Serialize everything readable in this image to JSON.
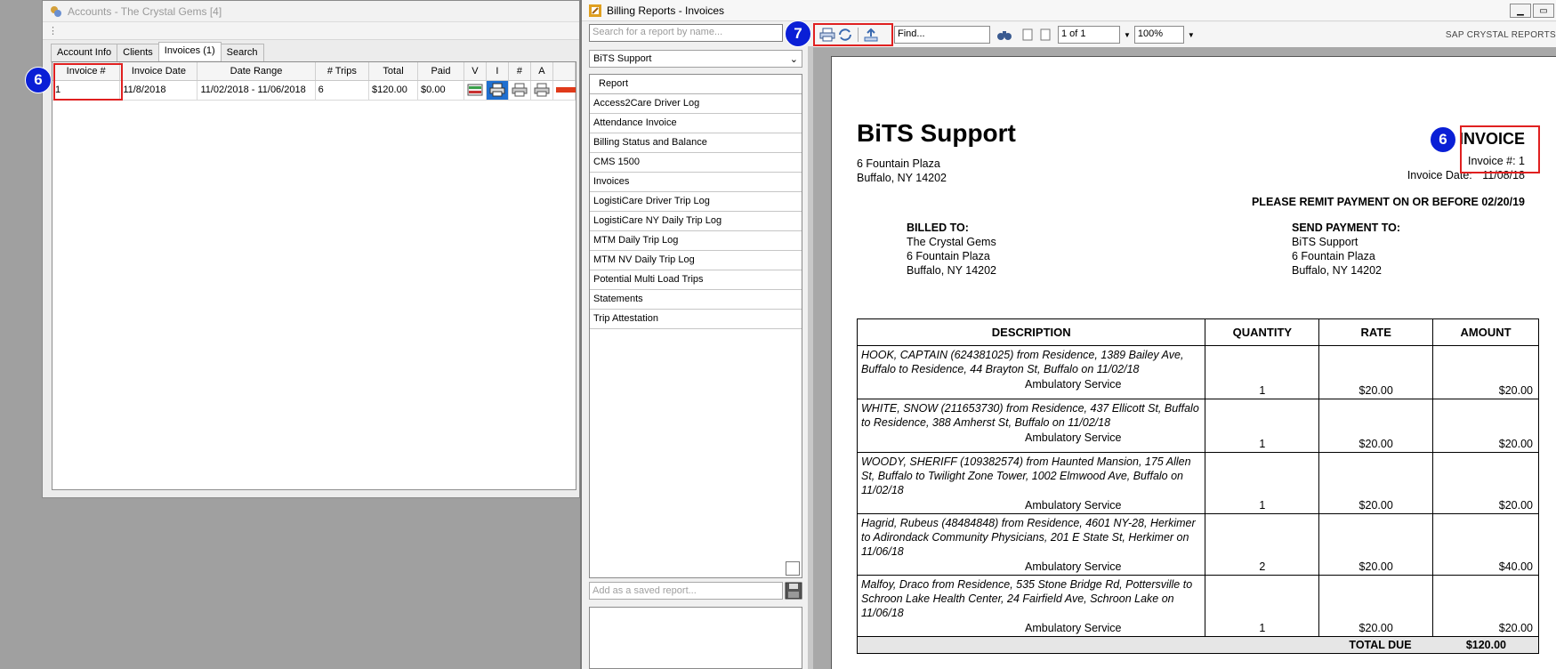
{
  "accounts": {
    "title": "Accounts - The Crystal Gems [4]",
    "tabs": [
      "Account Info",
      "Clients",
      "Invoices (1)",
      "Search"
    ],
    "columns": [
      "Invoice #",
      "Invoice Date",
      "Date Range",
      "# Trips",
      "Total",
      "Paid",
      "V",
      "I",
      "#",
      "A"
    ],
    "rows": [
      {
        "invoice": "1",
        "date": "11/8/2018",
        "range": "11/02/2018 - 11/06/2018",
        "trips": "6",
        "total": "$120.00",
        "paid": "$0.00"
      }
    ],
    "badge": "6"
  },
  "billing": {
    "title": "Billing Reports - Invoices",
    "search_placeholder": "Search for a report by name...",
    "selected_company": "BiTS Support",
    "report_header": "Report",
    "reports": [
      "Access2Care Driver Log",
      "Attendance Invoice",
      "Billing Status and Balance",
      "CMS 1500",
      "Invoices",
      "LogistiCare Driver Trip Log",
      "LogistiCare NY Daily Trip Log",
      "MTM Daily Trip Log",
      "MTM NV Daily Trip Log",
      "Potential Multi Load Trips",
      "Statements",
      "Trip Attestation"
    ],
    "saved_placeholder": "Add as a saved report...",
    "toolbar": {
      "badge": "7",
      "find": "Find...",
      "page": "1 of 1",
      "zoom": "100%",
      "brand": "SAP CRYSTAL REPORTS"
    }
  },
  "invoice": {
    "company": "BiTS Support",
    "company_addr1": "6 Fountain Plaza",
    "company_addr2": "Buffalo, NY 14202",
    "title": "INVOICE",
    "badge": "6",
    "number_label": "Invoice #:",
    "number": "1",
    "date_label": "Invoice Date:",
    "date": "11/08/18",
    "remit": "PLEASE REMIT PAYMENT ON OR BEFORE 02/20/19",
    "billed_to": {
      "head": "BILLED TO:",
      "l1": "The Crystal Gems",
      "l2": "6 Fountain Plaza",
      "l3": "Buffalo, NY 14202"
    },
    "send_to": {
      "head": "SEND PAYMENT TO:",
      "l1": "BiTS Support",
      "l2": "6 Fountain Plaza",
      "l3": "Buffalo, NY 14202"
    },
    "columns": [
      "DESCRIPTION",
      "QUANTITY",
      "RATE",
      "AMOUNT"
    ],
    "items": [
      {
        "desc": "HOOK, CAPTAIN (624381025) from Residence, 1389 Bailey Ave, Buffalo to Residence, 44 Brayton St, Buffalo on 11/02/18",
        "service": "Ambulatory Service",
        "qty": "1",
        "rate": "$20.00",
        "amount": "$20.00"
      },
      {
        "desc": "WHITE, SNOW (211653730) from Residence, 437 Ellicott St, Buffalo to Residence, 388 Amherst St, Buffalo on 11/02/18",
        "service": "Ambulatory Service",
        "qty": "1",
        "rate": "$20.00",
        "amount": "$20.00"
      },
      {
        "desc": "WOODY, SHERIFF (109382574) from Haunted Mansion, 175 Allen St, Buffalo to Twilight Zone Tower, 1002 Elmwood Ave, Buffalo on 11/02/18",
        "service": "Ambulatory Service",
        "qty": "1",
        "rate": "$20.00",
        "amount": "$20.00"
      },
      {
        "desc": "Hagrid, Rubeus (48484848) from Residence, 4601 NY-28, Herkimer to Adirondack Community Physicians, 201 E State St, Herkimer on 11/06/18",
        "service": "Ambulatory Service",
        "qty": "2",
        "rate": "$20.00",
        "amount": "$40.00"
      },
      {
        "desc": "Malfoy, Draco from Residence, 535 Stone Bridge Rd, Pottersville to Schroon Lake Health Center, 24 Fairfield Ave, Schroon Lake on 11/06/18",
        "service": "Ambulatory Service",
        "qty": "1",
        "rate": "$20.00",
        "amount": "$20.00"
      }
    ],
    "total_label": "TOTAL DUE",
    "total": "$120.00"
  }
}
